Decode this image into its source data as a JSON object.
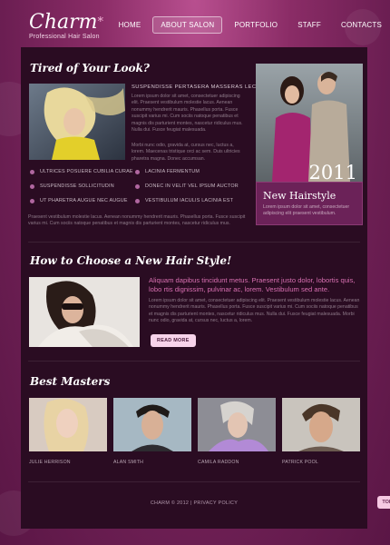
{
  "logo": {
    "title": "Charm",
    "star": "*",
    "tagline": "Professional Hair Salon"
  },
  "nav": [
    "HOME",
    "ABOUT SALON",
    "PORTFOLIO",
    "STAFF",
    "CONTACTS"
  ],
  "nav_active": "ABOUT SALON",
  "section1": {
    "title": "Tired of Your Look?",
    "heading": "SUSPENDISSE PERTASERA MASSERAS LECTUS",
    "para1": "Lorem ipsum dolor sit amet, consectetuer adipiscing elit. Praesent vestibulum molestie lacus. Aenean nonummy hendrerit mauris. Phasellus porta. Fusce suscipit varius mi. Cum sociis natoque penatibus et magnis dis parturient montes, nascetur ridiculus mus. Nulla dui. Fusce feugiat malesuada.",
    "para2": "Morbi nunc odio, gravida at, cursus nec, luctus a, lorem. Maecenas tristique orci ac sem. Duis ultricies pharetra magna. Donec accumsan.",
    "list_left": [
      "ULTRICES POSUERE CUBILIA CURAE",
      "SUSPENDISSE SOLLICITUDIN",
      "UT PHARETRA AUGUE NEC AUGUE"
    ],
    "list_right": [
      "LACINIA FERMENTUM",
      "DONEC IN VELIT VEL IPSUM AUCTOR",
      "VESTIBULUM IACULIS LACINIA EST"
    ],
    "bottom_para": "Praesent vestibulum molestie lacus. Aenean nonummy hendrerit mauris. Phasellus porta. Fusce suscipit varius mi. Cum sociis natoque penatibus et magnis dis parturient montes, nascetur ridiculus mus."
  },
  "promo": {
    "year": "2011",
    "title": "New Hairstyle",
    "text": "Lorem ipsum dolor sit amet, consectetuer adipiscing elit praesent vestibulum."
  },
  "section2": {
    "title": "How to Choose a New Hair Style!",
    "lead": "Aliquam dapibus tincidunt metus. Praesent justo dolor, lobortis quis, lobo rtis dignissim, pulvinar ac, lorem. Vestibulum sed ante.",
    "para": "Lorem ipsum dolor sit amet, consectetuer adipiscing elit. Praesent vestibulum molestie lacus. Aenean nonummy hendrerit mauris. Phasellus porta. Fusce suscipit varius mi. Cum sociis natoque penatibus et magnis dis parturient montes, nascetur ridiculus mus. Nulla dui. Fusce feugiat malesuada. Morbi nunc odio, gravida at, cursus nec, luctus a, lorem.",
    "button": "READ MORE"
  },
  "section3": {
    "title": "Best Masters",
    "masters": [
      "JULIE HERRISON",
      "ALAN SMITH",
      "CAMILA RADDON",
      "PATRICK POOL"
    ]
  },
  "footer": {
    "text": "CHARM © 2012  |  PRIVACY POLICY"
  },
  "top_button": "TOP",
  "colors": {
    "accent": "#d76fb0",
    "panel": "#2a0c22",
    "background": "#7a2560"
  }
}
